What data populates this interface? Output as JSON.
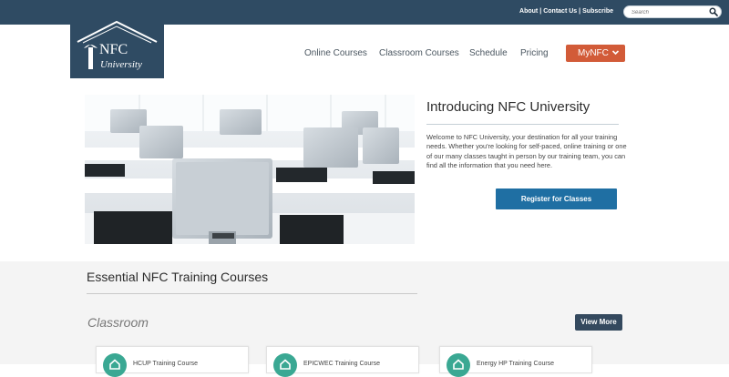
{
  "topbar": {
    "links": [
      "About",
      "Contact Us",
      "Subscribe"
    ],
    "separator": "|",
    "search_placeholder": "Search"
  },
  "logo": {
    "line1": "NFC",
    "line2": "University"
  },
  "nav": {
    "items": [
      "Online Courses",
      "Classroom Courses",
      "Schedule",
      "Pricing"
    ],
    "account_label": "MyNFC"
  },
  "hero": {
    "title": "Introducing NFC University",
    "text": "Welcome to NFC University, your destination for all your training needs. Whether you're looking for self-paced, online training or one of our many classes taught in person by our training team, you can find all the information that you need here.",
    "button_label": "Register for Classes"
  },
  "section": {
    "title": "Essential NFC Training Courses",
    "subtitle": "Classroom",
    "view_more_label": "View More",
    "cards": [
      {
        "title": "HCUP Training Course"
      },
      {
        "title": "EPICWEC Training Course"
      },
      {
        "title": "Energy HP Training Course"
      }
    ]
  },
  "colors": {
    "header": "#2f4b63",
    "accent_orange": "#d25b38",
    "button_blue": "#1f6fa3",
    "view_more": "#34495e",
    "card_icon": "#3aa893"
  },
  "icons": {
    "search": "search-icon",
    "chevron": "chevron-down-icon",
    "logo": "house-logo-icon",
    "card": "house-icon"
  }
}
